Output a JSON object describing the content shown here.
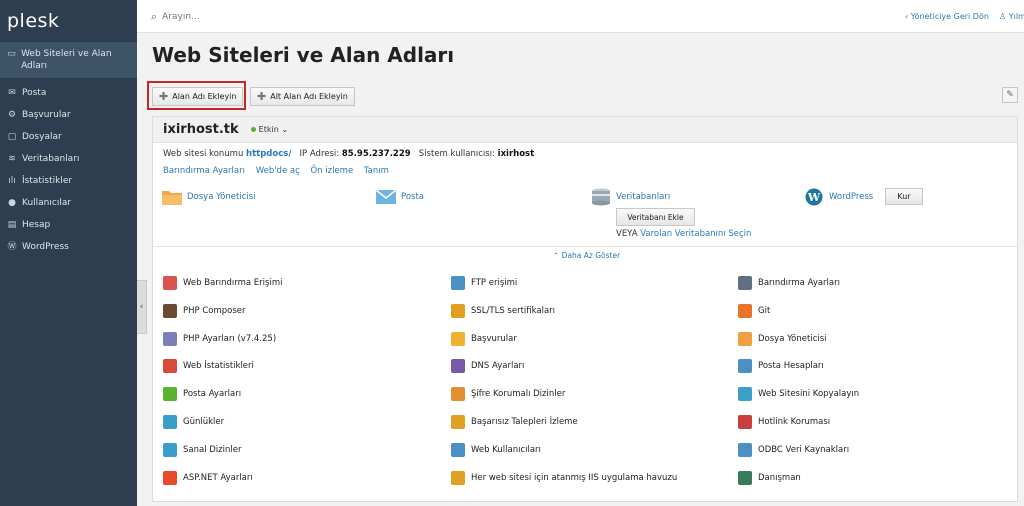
{
  "sidebar": {
    "logo": "plesk",
    "items": [
      {
        "label": "Web Siteleri ve Alan Adları",
        "icon": "monitor-icon",
        "glyph": "▭"
      },
      {
        "label": "Posta",
        "icon": "mail-icon",
        "glyph": "✉"
      },
      {
        "label": "Başvurular",
        "icon": "gear-icon",
        "glyph": "⚙"
      },
      {
        "label": "Dosyalar",
        "icon": "folder-icon",
        "glyph": "▢"
      },
      {
        "label": "Veritabanları",
        "icon": "database-icon",
        "glyph": "≋"
      },
      {
        "label": "İstatistikler",
        "icon": "bar-chart-icon",
        "glyph": "ılı"
      },
      {
        "label": "Kullanıcılar",
        "icon": "user-icon",
        "glyph": "●"
      },
      {
        "label": "Hesap",
        "icon": "account-icon",
        "glyph": "▤"
      },
      {
        "label": "WordPress",
        "icon": "wordpress-icon",
        "glyph": "Ⓦ"
      }
    ]
  },
  "topbar": {
    "search_placeholder": "Arayın...",
    "back_admin": "‹ Yöneticiye Geri Dön",
    "user": "♙ Yılm"
  },
  "page": {
    "title": "Web Siteleri ve Alan Adları"
  },
  "toolbar": {
    "add_domain": "Alan Adı Ekleyin",
    "add_subdomain": "Alt Alan Adı Ekleyin"
  },
  "domain": {
    "name": "ixirhost.tk",
    "status": "Etkin ⌄",
    "info_site_label": "Web sitesi konumu",
    "info_site_value": "httpdocs/",
    "info_ip_label": "IP Adresi:",
    "info_ip_value": "85.95.237.229",
    "info_user_label": "Sistem kullanıcısı:",
    "info_user_value": "ixirhost",
    "links": [
      "Barındırma Ayarları",
      "Web'de aç",
      "Ön izleme",
      "Tanım"
    ]
  },
  "quick": {
    "file_manager": "Dosya Yöneticisi",
    "mail": "Posta",
    "databases": "Veritabanları",
    "wordpress": "WordPress",
    "install": "Kur",
    "add_db": "Veritabanı Ekle",
    "or": "VEYA",
    "select_db": "Varolan Veritabanını Seçin",
    "show_less": "⌃ Daha Az Göster"
  },
  "colors": {
    "sidebar": "#2c3e50",
    "link": "#2a78b5",
    "highlight": "#c8262b"
  },
  "tools": [
    {
      "label": "Web Barındırma Erişimi",
      "icon": "hosting-access-icon",
      "color": "#d9534f"
    },
    {
      "label": "FTP erişimi",
      "icon": "ftp-icon",
      "color": "#4a90c2"
    },
    {
      "label": "Barındırma Ayarları",
      "icon": "hosting-settings-icon",
      "color": "#607080"
    },
    {
      "label": "PHP Composer",
      "icon": "composer-icon",
      "color": "#6b4a2f"
    },
    {
      "label": "SSL/TLS sertifikaları",
      "icon": "lock-icon",
      "color": "#e0a020"
    },
    {
      "label": "Git",
      "icon": "git-icon",
      "color": "#e8742b"
    },
    {
      "label": "PHP Ayarları (v7.4.25)",
      "icon": "php-icon",
      "color": "#7b7fb5"
    },
    {
      "label": "Başvurular",
      "icon": "applications-icon",
      "color": "#f0b030"
    },
    {
      "label": "Dosya Yöneticisi",
      "icon": "folder-icon",
      "color": "#f0a040"
    },
    {
      "label": "Web İstatistikleri",
      "icon": "stats-icon",
      "color": "#d84a3a"
    },
    {
      "label": "DNS Ayarları",
      "icon": "dns-icon",
      "color": "#7a5aa8"
    },
    {
      "label": "Posta Hesapları",
      "icon": "mail-accounts-icon",
      "color": "#4a90c2"
    },
    {
      "label": "Posta Ayarları",
      "icon": "mail-settings-icon",
      "color": "#5ab22e"
    },
    {
      "label": "Şifre Korumalı Dizinler",
      "icon": "protected-dir-icon",
      "color": "#e09030"
    },
    {
      "label": "Web Sitesini Kopyalayın",
      "icon": "copy-site-icon",
      "color": "#3aa0c8"
    },
    {
      "label": "Günlükler",
      "icon": "logs-icon",
      "color": "#3aa0c8"
    },
    {
      "label": "Başarısız Talepleri İzleme",
      "icon": "failed-requests-icon",
      "color": "#e0a020"
    },
    {
      "label": "Hotlink Koruması",
      "icon": "hotlink-icon",
      "color": "#c84040"
    },
    {
      "label": "Sanal Dizinler",
      "icon": "virtual-dir-icon",
      "color": "#3aa0c8"
    },
    {
      "label": "Web Kullanıcıları",
      "icon": "web-users-icon",
      "color": "#4a90c2"
    },
    {
      "label": "ODBC Veri Kaynakları",
      "icon": "odbc-icon",
      "color": "#4a90c2"
    },
    {
      "label": "ASP.NET Ayarları",
      "icon": "aspnet-icon",
      "color": "#e84a2a"
    },
    {
      "label": "Her web sitesi için atanmış IIS uygulama havuzu",
      "icon": "iis-pool-icon",
      "color": "#e0a020"
    },
    {
      "label": "Danışman",
      "icon": "advisor-icon",
      "color": "#3a7a5a"
    }
  ]
}
